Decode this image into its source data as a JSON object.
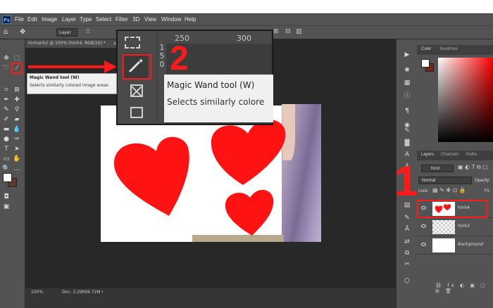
{
  "app": {
    "logo": "Ps",
    "menu": [
      "File",
      "Edit",
      "Image",
      "Layer",
      "Type",
      "Select",
      "Filter",
      "3D",
      "View",
      "Window",
      "Help"
    ]
  },
  "options_bar": {
    "sample_label": "Layer"
  },
  "document": {
    "tab_title": "hinhanh2 @ 100% (hinh4, RGB/16) *",
    "zoom": "100%",
    "doc_size": "Doc: 2.29M/6.72M"
  },
  "tooltip": {
    "title": "Magic Wand tool (W)",
    "desc": "Selects similarly colored image areas"
  },
  "zoom_inset": {
    "ruler_marks": [
      "250",
      "300"
    ],
    "ruler_side": "1 5 0",
    "title": "Magic Wand tool (W)",
    "desc": "Selects similarly colore"
  },
  "annotations": {
    "step1": "1",
    "step2": "2"
  },
  "panels": {
    "color_tabs": [
      "Color",
      "Swatches"
    ],
    "layer_tabs": [
      "Layers",
      "Channels",
      "Paths"
    ],
    "kind_label": "Kind",
    "blend_mode": "Normal",
    "opacity_label": "Opacity:",
    "lock_label": "Lock:",
    "fill_label": "Fil:",
    "layers": [
      {
        "name": "hinh4"
      },
      {
        "name": "hinh3"
      },
      {
        "name": "Background"
      }
    ]
  },
  "colors": {
    "accent": "#ff1a1a",
    "heart": "#ff1212",
    "hair": "#8e7aa6"
  }
}
